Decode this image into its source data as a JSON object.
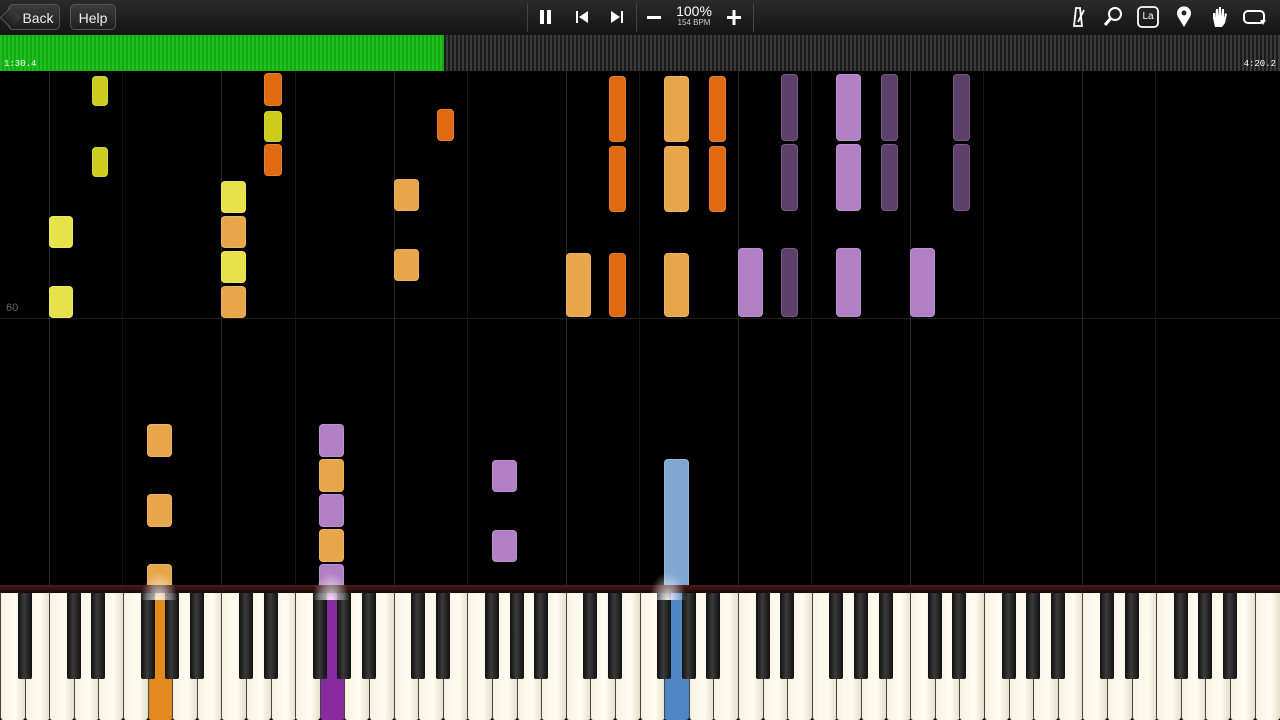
{
  "toolbar": {
    "back_label": "Back",
    "help_label": "Help",
    "speed_percent": "100%",
    "speed_bpm": "154 BPM",
    "icons": [
      "pause-icon",
      "skip-back-icon",
      "skip-forward-icon",
      "minus-icon",
      "plus-icon",
      "metronome-icon",
      "search-icon",
      "language-icon",
      "location-pin-icon",
      "hand-icon",
      "loop-icon"
    ],
    "language_label": "La"
  },
  "progress": {
    "current_time": "1:30.4",
    "total_time": "4:20.2",
    "fraction": 0.347
  },
  "piano_roll": {
    "pitch_label": "60"
  },
  "colors": {
    "progress": "#1ec01e",
    "yellow": "#e8e24a",
    "olive": "#cccc1e",
    "light_orange": "#e8a64a",
    "orange": "#e06a10",
    "light_purple": "#b07fc4",
    "dark_purple": "#5e3e6a",
    "blue": "#7fa7d0",
    "active_orange": "#e38a1e",
    "active_purple": "#8a2aa0",
    "active_blue": "#4f86c4"
  }
}
